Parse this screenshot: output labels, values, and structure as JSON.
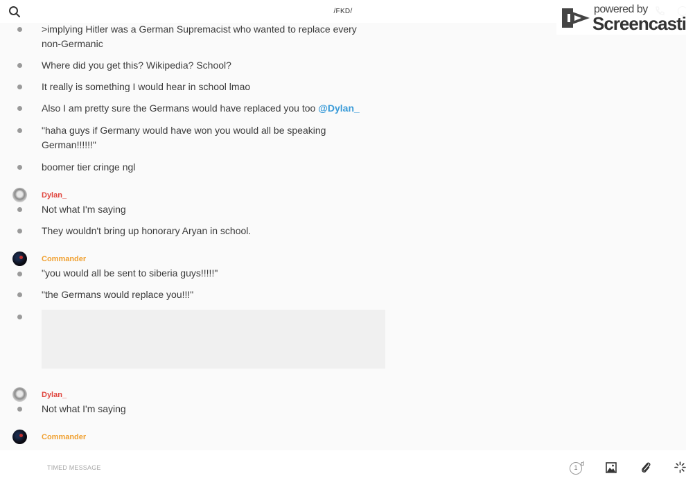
{
  "header": {
    "channel_title": "/FKD/"
  },
  "watermark": {
    "powered_by": "powered by",
    "brand": "Screencastify"
  },
  "messages": [
    {
      "type": "text",
      "text": ">implying Hitler was a German Supremacist who wanted to replace every"
    },
    {
      "type": "text",
      "text": "non-Germanic"
    },
    {
      "type": "text",
      "text": "Where did you get this? Wikipedia? School?"
    },
    {
      "type": "text",
      "text": "It really is something I would hear in school lmao"
    },
    {
      "type": "text",
      "text": "Also I am pretty sure the Germans would have replaced you too",
      "mention": "@Dylan_"
    },
    {
      "type": "text",
      "text": "\"haha guys if Germany would have won you would all be speaking"
    },
    {
      "type": "text",
      "text": "German!!!!!!\""
    },
    {
      "type": "text",
      "text": "boomer tier cringe ngl"
    }
  ],
  "groups": [
    {
      "author": "Dylan_",
      "author_color": "#e0463f",
      "messages": [
        "Not what I'm saying",
        "They wouldn't bring up honorary Aryan in school."
      ]
    },
    {
      "author": "Commander",
      "author_color": "#f0a030",
      "messages": [
        "\"you would all be sent to siberia guys!!!!!\"",
        "\"the Germans would replace you!!!\""
      ]
    },
    {
      "author": "Dylan_",
      "author_color": "#e0463f",
      "messages": [
        "Not what I'm saying"
      ]
    },
    {
      "author": "Commander",
      "author_color": "#f0a030",
      "messages": []
    }
  ],
  "composer": {
    "placeholder": "TIMED MESSAGE",
    "timer_value": "1",
    "timer_unit": "d"
  }
}
